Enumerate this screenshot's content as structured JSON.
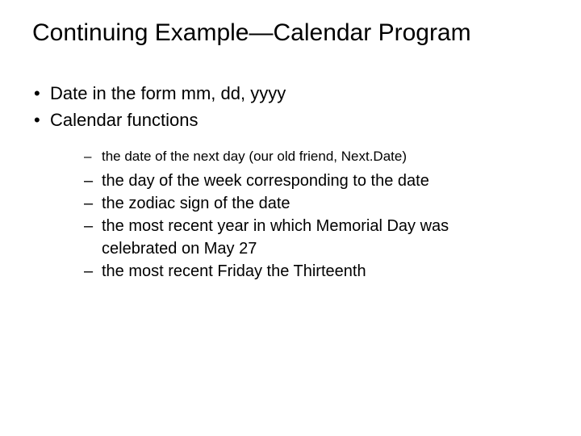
{
  "title": "Continuing Example—Calendar Program",
  "bullets": {
    "b1": "Date in the form mm, dd, yyyy",
    "b2": "Calendar functions"
  },
  "sub": {
    "s1": "the date of the next day (our old friend, Next.Date)",
    "s2": "the day of the week corresponding to the date",
    "s3": "the zodiac sign of the date",
    "s4": "the most recent year in which Memorial Day was",
    "s4b": "celebrated on May 27",
    "s5": "the most recent Friday the Thirteenth"
  }
}
